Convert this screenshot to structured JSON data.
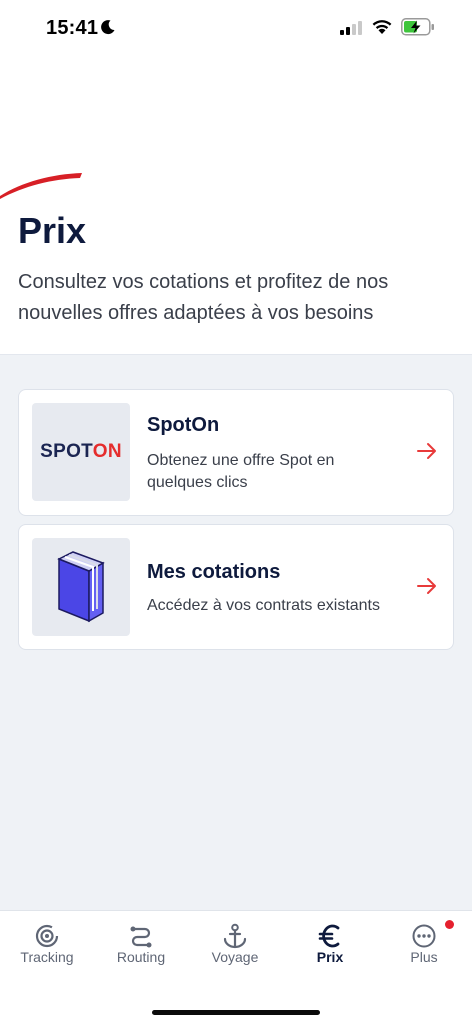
{
  "status_bar": {
    "time": "15:41"
  },
  "header": {
    "title": "Prix",
    "subtitle": "Consultez vos cotations et profitez de nos nouvelles offres adaptées à vos besoins"
  },
  "cards": [
    {
      "logo_part1": "SPOT",
      "logo_part2": "ON",
      "title": "SpotOn",
      "description": "Obtenez une offre Spot en quelques clics"
    },
    {
      "title": "Mes cotations",
      "description": "Accédez à vos contrats existants"
    }
  ],
  "tabbar": {
    "items": [
      {
        "label": "Tracking",
        "icon": "tracking-icon"
      },
      {
        "label": "Routing",
        "icon": "routing-icon"
      },
      {
        "label": "Voyage",
        "icon": "anchor-icon"
      },
      {
        "label": "Prix",
        "icon": "euro-icon",
        "active": true
      },
      {
        "label": "Plus",
        "icon": "more-icon"
      }
    ]
  },
  "colors": {
    "brand_navy": "#0e1a3d",
    "accent_red": "#e52d2d",
    "background": "#eff2f6",
    "notification": "#e5202e"
  }
}
